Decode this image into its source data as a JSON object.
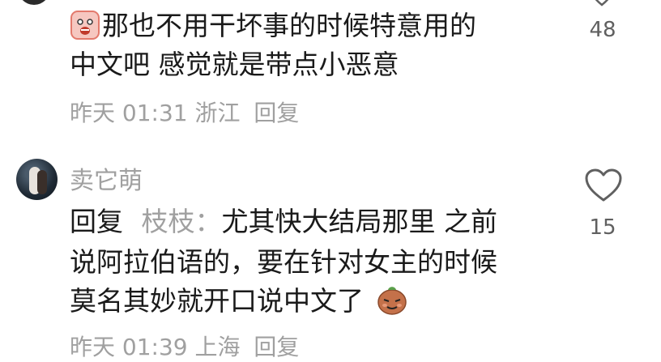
{
  "comment1": {
    "text_line1": "那也不用干坏事的时候特意用的",
    "text_line2": "中文吧 感觉就是带点小恶意",
    "emoji": "scared-face-sticker-icon",
    "time": "昨天 01:31",
    "location": "浙江",
    "reply_label": "回复",
    "likes": "48"
  },
  "comment2": {
    "username": "卖它萌",
    "reply_prefix": "回复",
    "reply_target": "枝枝：",
    "text_line1": "尤其快大结局那里 之前",
    "text_line2": "说阿拉伯语的，要在针对女主的时候",
    "text_line3": "莫名其妙就开口说中文了",
    "emoji": "smug-bean-sticker-icon",
    "likes": "15",
    "time": "昨天 01:39",
    "location": "上海",
    "reply_label": "回复"
  },
  "colors": {
    "text": "#1a1a1a",
    "muted": "#a0a0a0",
    "count": "#606060"
  }
}
